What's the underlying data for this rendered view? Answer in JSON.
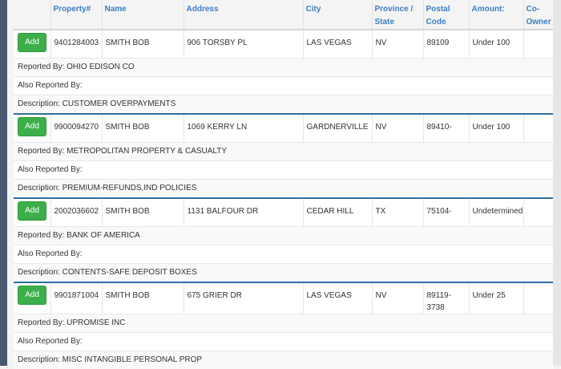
{
  "headers": {
    "property": "Property#",
    "name": "Name",
    "address": "Address",
    "city": "City",
    "province_a": "Province /",
    "province_b": "State",
    "postal_a": "Postal",
    "postal_b": "Code",
    "amount": "Amount:",
    "coowner_a": "Co-",
    "coowner_b": "Owner"
  },
  "labels": {
    "add": "Add",
    "reported_by": "Reported By:",
    "also_reported_by": "Also Reported By:",
    "description": "Description:"
  },
  "records": [
    {
      "property": "9401284003",
      "name": "SMITH BOB",
      "address": "906 TORSBY PL",
      "city": "LAS VEGAS",
      "state": "NV",
      "postal": "89109",
      "amount": "Under 100",
      "reported_by": "OHIO EDISON CO",
      "also_reported_by": "",
      "description": "CUSTOMER OVERPAYMENTS"
    },
    {
      "property": "9900094270",
      "name": "SMITH BOB",
      "address": "1069 KERRY LN",
      "city": "GARDNERVILLE",
      "state": "NV",
      "postal": "89410-",
      "amount": "Under 100",
      "reported_by": "METROPOLITAN PROPERTY & CASUALTY",
      "also_reported_by": "",
      "description": "PREMIUM-REFUNDS,IND POLICIES"
    },
    {
      "property": "2002036602",
      "name": "SMITH BOB",
      "address": "1131 BALFOUR DR",
      "city": "CEDAR HILL",
      "state": "TX",
      "postal": "75104-",
      "amount": "Undetermined",
      "reported_by": "BANK OF AMERICA",
      "also_reported_by": "",
      "description": "CONTENTS-SAFE DEPOSIT BOXES"
    },
    {
      "property": "9901871004",
      "name": "SMITH BOB",
      "address": "675 GRIER DR",
      "city": "LAS VEGAS",
      "state": "NV",
      "postal": "89119-3738",
      "amount": "Under 25",
      "reported_by": "UPROMISE INC",
      "also_reported_by": "",
      "description": "MISC INTANGIBLE PERSONAL PROP"
    }
  ]
}
